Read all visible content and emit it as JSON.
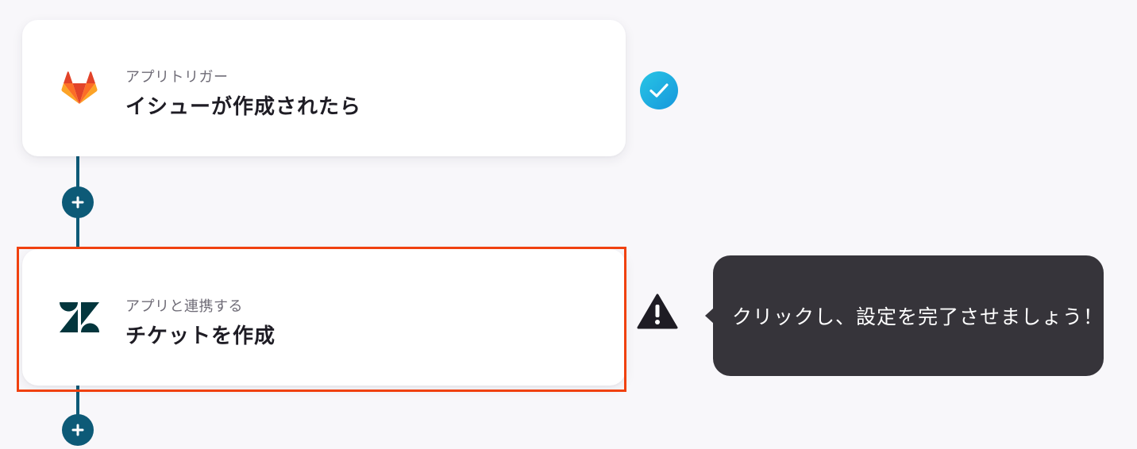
{
  "flow": {
    "steps": [
      {
        "subtitle": "アプリトリガー",
        "title": "イシューが作成されたら",
        "app_icon": "gitlab-icon",
        "status": "completed",
        "status_icon": "check-circle-icon"
      },
      {
        "subtitle": "アプリと連携する",
        "title": "チケットを作成",
        "app_icon": "zendesk-icon",
        "status": "warning",
        "status_icon": "warning-icon",
        "highlighted": true
      }
    ],
    "add_step_icon": "plus-icon"
  },
  "tooltip": {
    "text": "クリックし、設定を完了させましょう！"
  },
  "colors": {
    "background": "#f8f7fa",
    "connector": "#0d5a77",
    "highlight": "#f0410f",
    "check": "#1fb1e3",
    "tooltip_bg": "#36343a",
    "gitlab_orange": "#fc6d26",
    "zendesk_dark": "#03363d"
  }
}
